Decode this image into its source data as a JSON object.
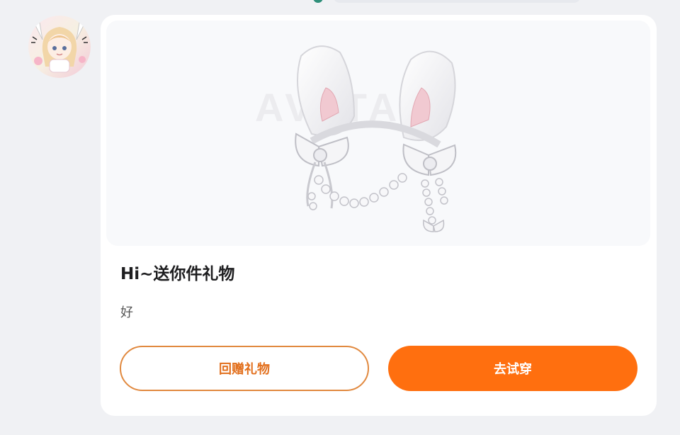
{
  "gift_card": {
    "watermark": "AVATAR",
    "title": "Hi~送你件礼物",
    "message": "好",
    "return_gift_label": "回赠礼物",
    "try_on_label": "去试穿",
    "image": "bunny-ear-headband-with-bow-and-pearls"
  },
  "sender": {
    "avatar": "anime-girl-avatar"
  },
  "colors": {
    "accent": "#ff6f0f",
    "outline": "#e1893f",
    "outline_text": "#e26f1c",
    "background": "#f0f1f4",
    "card": "#ffffff"
  }
}
